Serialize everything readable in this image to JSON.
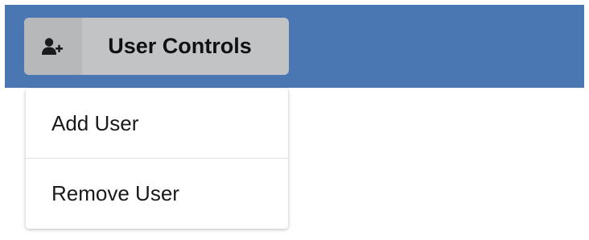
{
  "header": {
    "background_color": "#4a76b2",
    "button": {
      "label": "User Controls",
      "icon": "user-plus-icon",
      "background_color": "#c2c3c5"
    }
  },
  "dropdown": {
    "items": [
      {
        "label": "Add User"
      },
      {
        "label": "Remove User"
      }
    ]
  }
}
